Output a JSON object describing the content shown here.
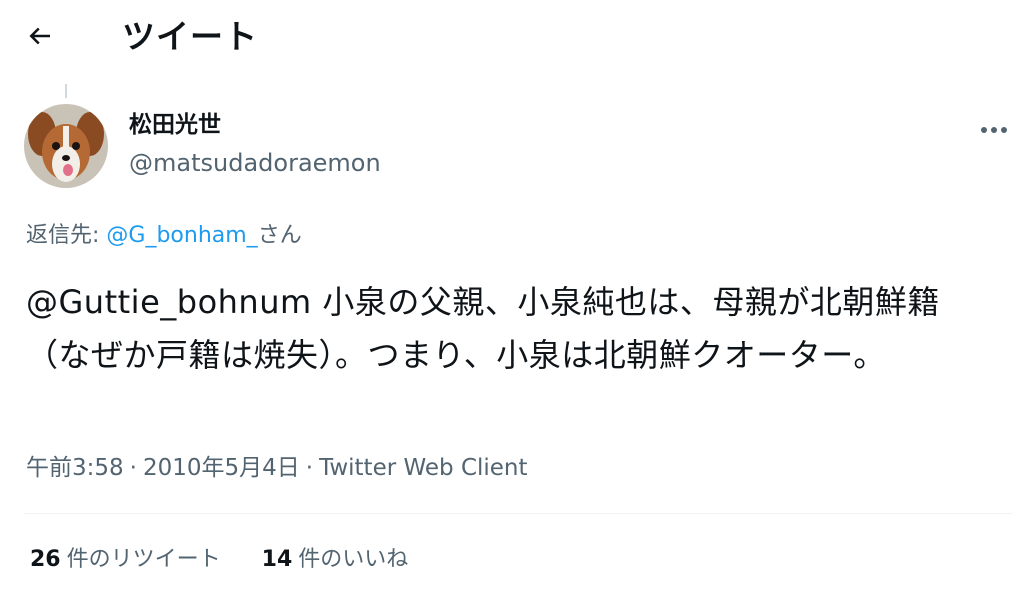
{
  "header": {
    "title": "ツイート",
    "back_icon": "arrow-left-icon"
  },
  "tweet": {
    "author": {
      "display_name": "松田光世",
      "handle": "@matsudadoraemon",
      "avatar_icon": "dog-avatar"
    },
    "reply": {
      "prefix": "返信先: ",
      "target": "@G_bonham_",
      "suffix": "さん"
    },
    "text": "@Guttie_bohnum 小泉の父親、小泉純也は、母親が北朝鮮籍（なぜか戸籍は焼失）。つまり、小泉は北朝鮮クオーター。",
    "meta": {
      "time": "午前3:58",
      "separator": "·",
      "date": "2010年5月4日",
      "client": "Twitter Web Client"
    },
    "stats": {
      "retweets_count": "26",
      "retweets_label": "件のリツイート",
      "likes_count": "14",
      "likes_label": "件のいいね"
    }
  },
  "colors": {
    "text_primary": "#0f1419",
    "text_secondary": "#536471",
    "link": "#1d9bf0",
    "divider": "#eff3f4"
  }
}
